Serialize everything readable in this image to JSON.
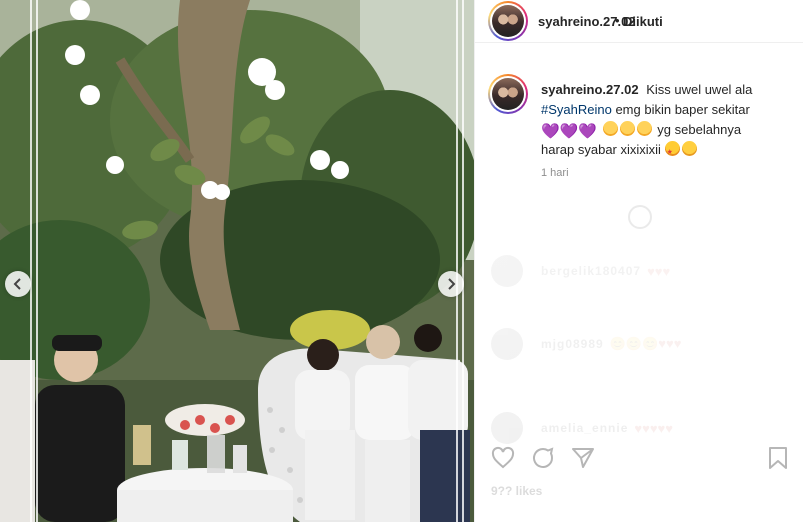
{
  "post": {
    "username": "syahreino.27.02",
    "follow_status": "Diikuti",
    "separator": "•",
    "caption_text_1": "Kiss uwel uwel ala",
    "hashtag": "#SyahReino",
    "caption_text_2": "emg bikin baper sekitar",
    "caption_text_3": "yg sebelahnya",
    "caption_text_4": "harap syabar xixixixii",
    "time_ago": "1 hari",
    "emoji_hearts": "💜💜💜",
    "icons": {
      "prev": "chevron-left-icon",
      "next": "chevron-right-icon",
      "like": "heart-icon",
      "comment": "comment-icon",
      "share": "share-icon",
      "save": "bookmark-icon"
    }
  },
  "comments": [
    {
      "user": "bergelik180407",
      "text": "♥♥♥"
    },
    {
      "user": "mjg08989",
      "text": "😊😊😊♥♥♥"
    },
    {
      "user": "amelia_ennie",
      "text": "♥♥♥♥♥"
    }
  ],
  "likes": "9?? likes",
  "colors": {
    "hashtag": "#00376b",
    "muted": "#8e8e8e",
    "text": "#262626"
  }
}
